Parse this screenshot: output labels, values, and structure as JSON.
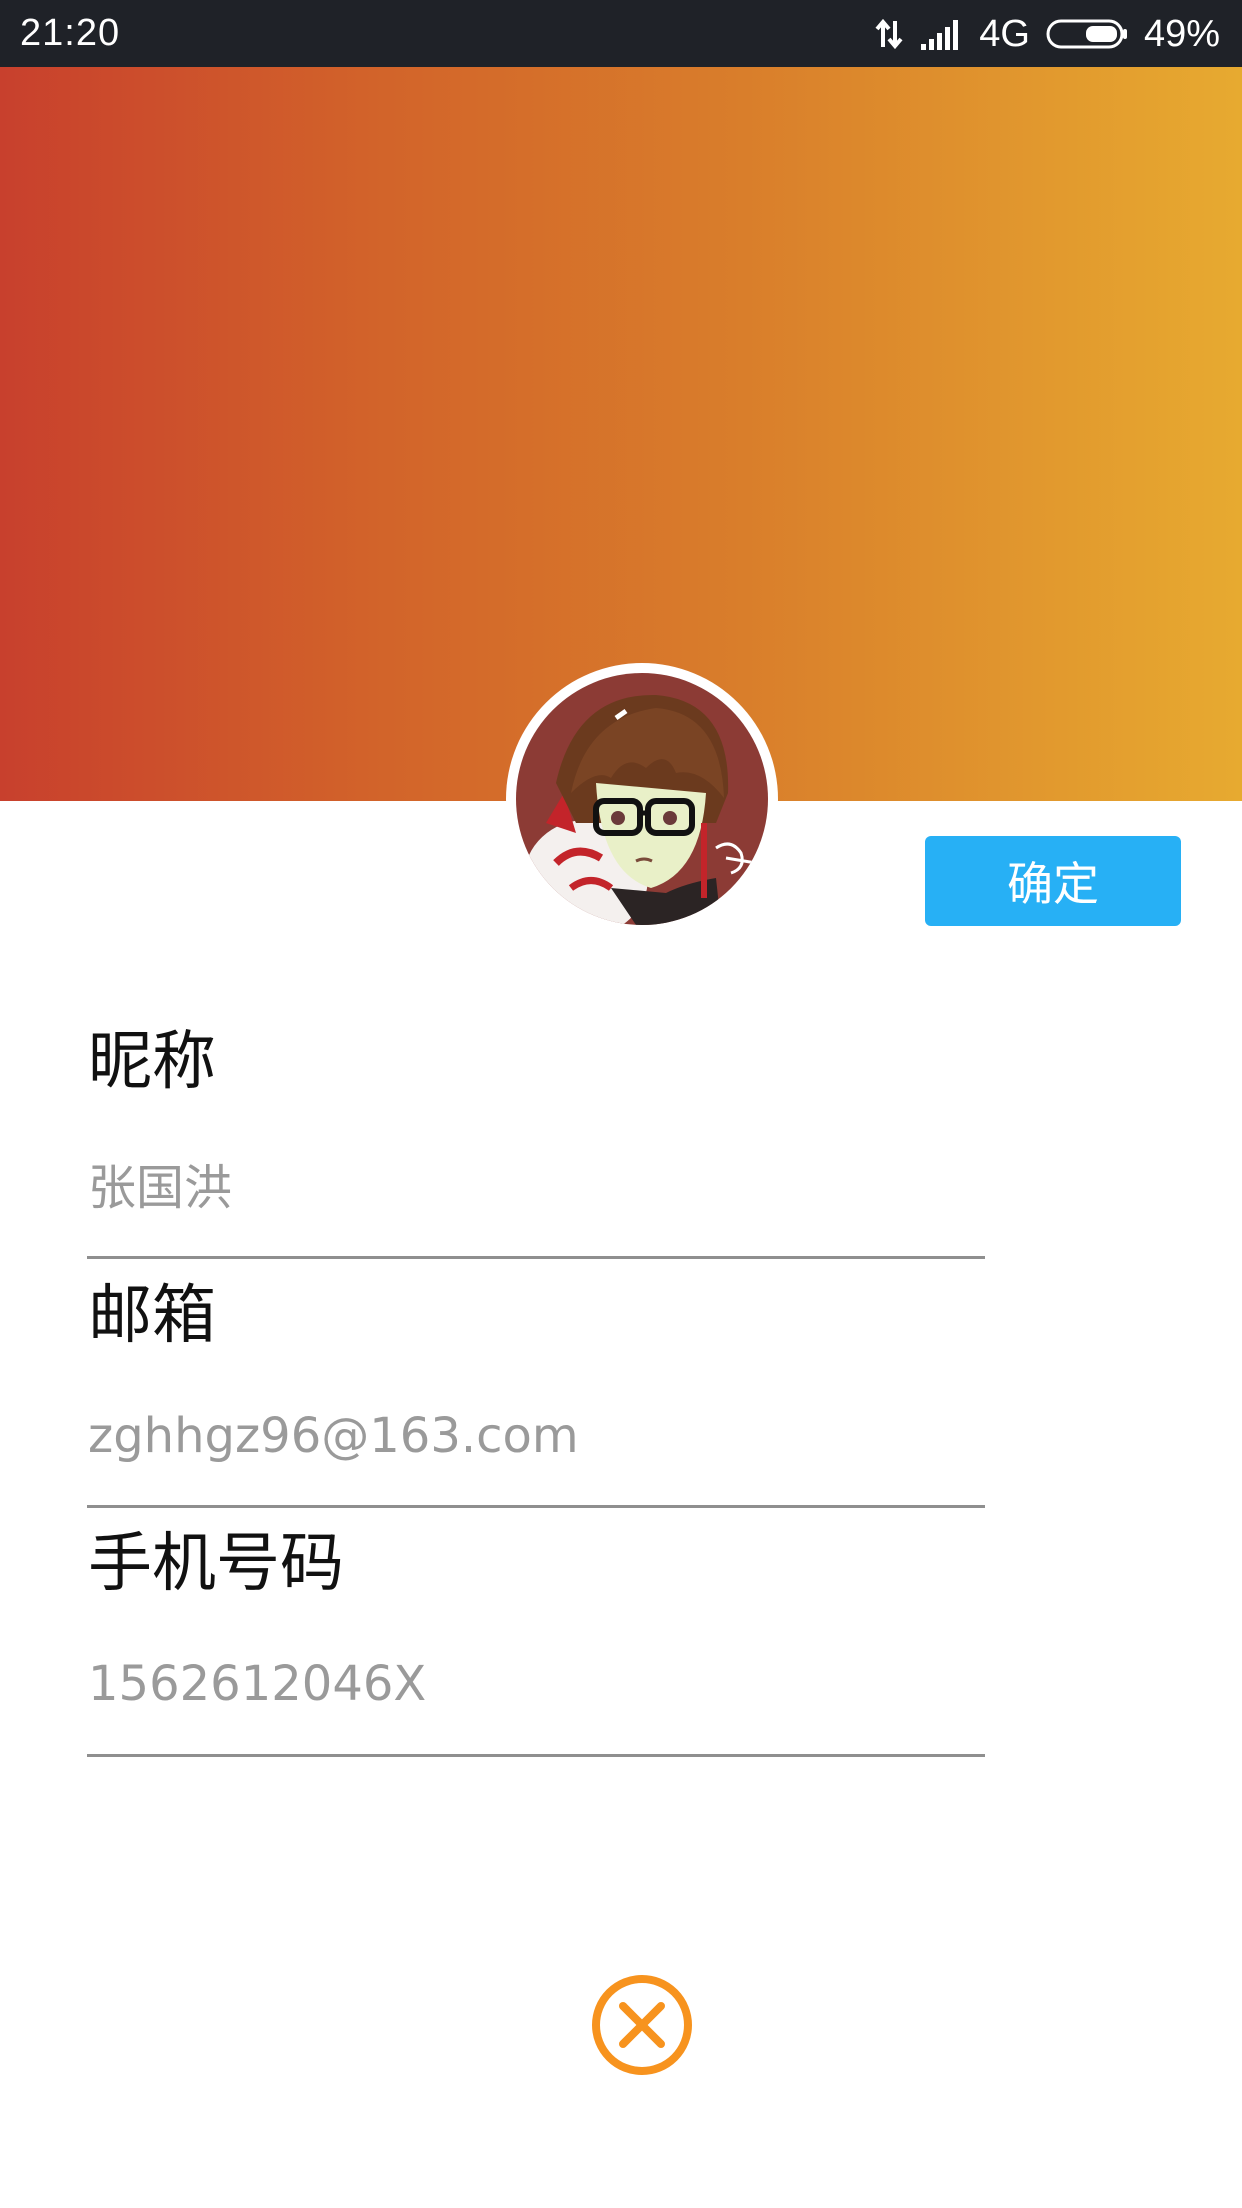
{
  "status_bar": {
    "time": "21:20",
    "network_type": "4G",
    "battery_percent": "49%",
    "icons": [
      "data-transfer-icon",
      "signal-icon",
      "battery-icon"
    ]
  },
  "header": {
    "gradient_colors": [
      "#c8402d",
      "#d2632a",
      "#d97e2b",
      "#e7aa30"
    ]
  },
  "profile": {
    "avatar_icon": "user-avatar-illustration",
    "confirm_label": "确定"
  },
  "fields": {
    "nickname": {
      "label": "昵称",
      "value": "张国洪"
    },
    "email": {
      "label": "邮箱",
      "value": "zghhgz96@163.com"
    },
    "phone": {
      "label": "手机号码",
      "value": "1562612046X"
    }
  },
  "close": {
    "icon": "close-circle-icon",
    "color": "#f7931e"
  },
  "colors": {
    "accent_blue": "#27b0f5",
    "label_text": "#111111",
    "value_text": "#9a9a9a",
    "divider": "#8f8f8f"
  }
}
